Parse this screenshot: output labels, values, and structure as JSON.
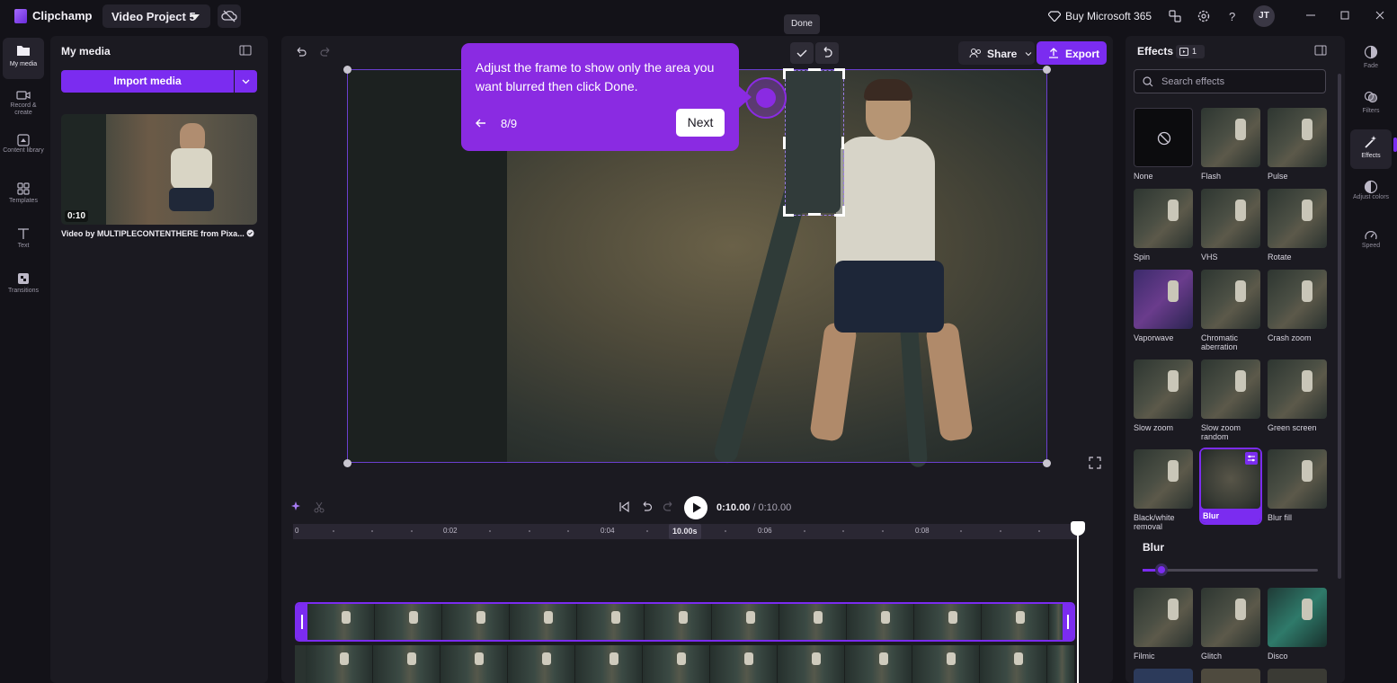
{
  "app": {
    "name": "Clipchamp",
    "project": "Video Project 5",
    "buy": "Buy Microsoft 365",
    "avatar": "JT"
  },
  "left_rail": [
    {
      "label": "My media",
      "icon": "folder-icon",
      "active": true
    },
    {
      "label": "Record & create",
      "icon": "camera-icon"
    },
    {
      "label": "Content library",
      "icon": "library-icon"
    },
    {
      "label": "Templates",
      "icon": "templates-icon"
    },
    {
      "label": "Text",
      "icon": "text-icon"
    },
    {
      "label": "Transitions",
      "icon": "transitions-icon"
    }
  ],
  "media": {
    "title": "My media",
    "import_label": "Import media",
    "clip": {
      "duration": "0:10",
      "name": "Video by MULTIPLECONTENTHERE from Pixa..."
    }
  },
  "preview": {
    "done_tooltip": "Done",
    "share_label": "Share",
    "export_label": "Export"
  },
  "coach": {
    "text": "Adjust the frame to show only the area you want blurred then click Done.",
    "step": "8/9",
    "next_label": "Next"
  },
  "timeline": {
    "current": "0:10.00",
    "total": "/ 0:10.00",
    "ruler": [
      "0",
      "0:02",
      "0:04",
      "10.00s",
      "0:06",
      "0:08"
    ],
    "playhead_fraction": 1.0
  },
  "effects": {
    "title": "Effects",
    "count": "1",
    "search_placeholder": "Search effects",
    "items": [
      {
        "label": "None",
        "style": "none"
      },
      {
        "label": "Flash"
      },
      {
        "label": "Pulse"
      },
      {
        "label": "Spin"
      },
      {
        "label": "VHS"
      },
      {
        "label": "Rotate"
      },
      {
        "label": "Vaporwave",
        "style": "vapor"
      },
      {
        "label": "Chromatic aberration"
      },
      {
        "label": "Crash zoom"
      },
      {
        "label": "Slow zoom"
      },
      {
        "label": "Slow zoom random"
      },
      {
        "label": "Green screen"
      },
      {
        "label": "Black/white removal"
      },
      {
        "label": "Blur",
        "style": "blur",
        "selected": true
      },
      {
        "label": "Blur fill"
      },
      {
        "label": "Filmic"
      },
      {
        "label": "Glitch"
      },
      {
        "label": "Disco",
        "style": "disco"
      }
    ],
    "blur_section_title": "Blur",
    "blur_level": 0.1
  },
  "right_rail": [
    {
      "label": "Fade",
      "icon": "fade-icon"
    },
    {
      "label": "Filters",
      "icon": "filters-icon"
    },
    {
      "label": "Effects",
      "icon": "effects-icon",
      "active": true
    },
    {
      "label": "Adjust colors",
      "icon": "adjust-colors-icon"
    },
    {
      "label": "Speed",
      "icon": "speed-icon"
    }
  ],
  "colors": {
    "accent": "#7b2cf0",
    "coach": "#8a2be2",
    "bg": "#131218",
    "panel": "#1b1a21"
  }
}
